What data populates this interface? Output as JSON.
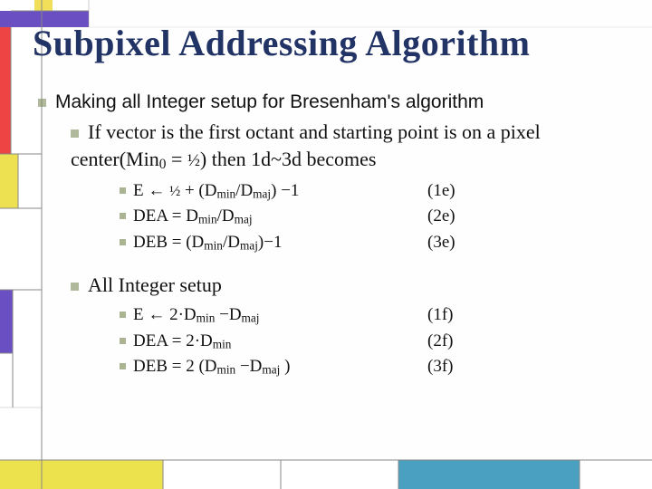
{
  "title": "Subpixel Addressing Algorithm",
  "main_bullet": "Making all Integer setup for Bresenham's algorithm",
  "sub1": "If vector is the first octant and starting point is on a pixel center(Min₀ = ½) then 1d~3d becomes",
  "eqs_e": [
    {
      "left": "E ← ½ + (Dₘᵢₙ/Dₘₐⱼ) −1",
      "right": "(1e)"
    },
    {
      "left": "DEA = Dₘᵢₙ/Dₘₐⱼ",
      "right": "(2e)"
    },
    {
      "left": "DEB = (Dₘᵢₙ/Dₘₐⱼ)−1",
      "right": "(3e)"
    }
  ],
  "sub2": "All Integer setup",
  "eqs_f": [
    {
      "left": "E ← 2·Dₘᵢₙ −Dₘₐⱼ",
      "right": "(1f)"
    },
    {
      "left": "DEA = 2·Dₘᵢₙ",
      "right": "(2f)"
    },
    {
      "left": "DEB = 2 (Dₘᵢₙ −Dₘₐⱼ )",
      "right": "(3f)"
    }
  ]
}
